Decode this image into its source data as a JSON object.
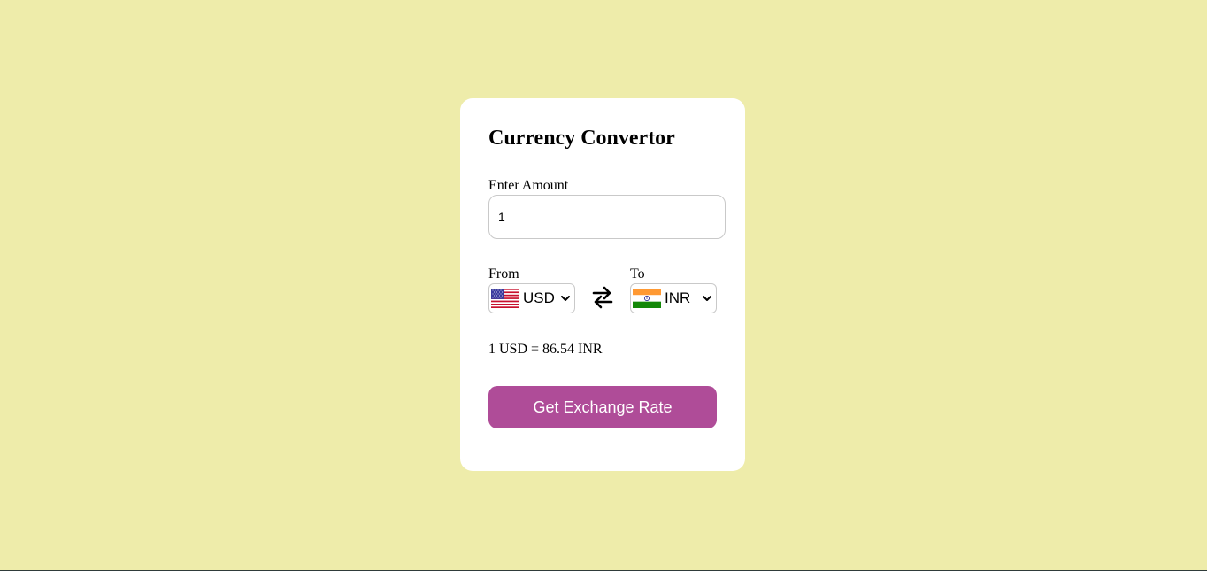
{
  "converter": {
    "title": "Currency Convertor",
    "amount_label": "Enter Amount",
    "amount_value": "1",
    "from_label": "From",
    "to_label": "To",
    "from_currency": "USD",
    "to_currency": "INR",
    "rate_text": "1 USD = 86.54 INR",
    "button_label": "Get Exchange Rate"
  },
  "icons": {
    "from_flag": "us-flag-icon",
    "to_flag": "india-flag-icon",
    "swap": "swap-arrows-icon",
    "dropdown": "chevron-down-icon"
  },
  "colors": {
    "background": "#eeecaa",
    "card": "#ffffff",
    "button": "#af4c98",
    "button_text": "#ffffff"
  }
}
